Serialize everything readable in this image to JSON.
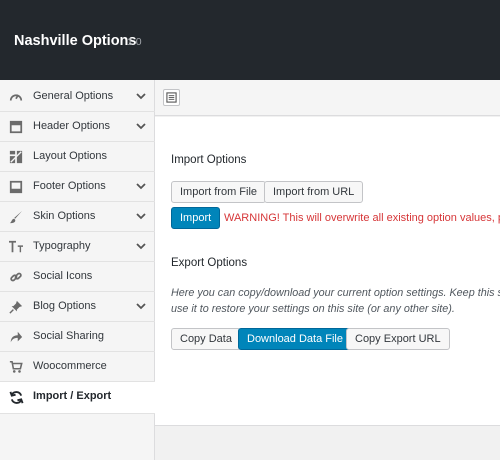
{
  "header": {
    "title": "Nashville Options",
    "version": "1.0"
  },
  "sidebar": {
    "items": [
      {
        "label": "General Options",
        "icon": "gauge-icon",
        "expandable": true
      },
      {
        "label": "Header Options",
        "icon": "header-layout-icon",
        "expandable": true
      },
      {
        "label": "Layout Options",
        "icon": "layout-icon",
        "expandable": false
      },
      {
        "label": "Footer Options",
        "icon": "footer-layout-icon",
        "expandable": true
      },
      {
        "label": "Skin Options",
        "icon": "brush-icon",
        "expandable": true
      },
      {
        "label": "Typography",
        "icon": "typography-icon",
        "expandable": true
      },
      {
        "label": "Social Icons",
        "icon": "link-icon",
        "expandable": false
      },
      {
        "label": "Blog Options",
        "icon": "pin-icon",
        "expandable": true
      },
      {
        "label": "Social Sharing",
        "icon": "share-icon",
        "expandable": false
      },
      {
        "label": "Woocommerce",
        "icon": "cart-icon",
        "expandable": false
      },
      {
        "label": "Import / Export",
        "icon": "refresh-icon",
        "expandable": false,
        "active": true
      }
    ]
  },
  "import": {
    "heading": "Import Options",
    "from_file": "Import from File",
    "from_url": "Import from URL",
    "import_button": "Import",
    "warning": "WARNING! This will overwrite all existing option values, please proceed with caution!"
  },
  "export": {
    "heading": "Export Options",
    "description_line1": "Here you can copy/download your current option settings. Keep this safe as you can",
    "description_line2": "use it to restore your settings on this site (or any other site).",
    "copy_data": "Copy Data",
    "download": "Download Data File",
    "copy_url": "Copy Export URL"
  },
  "colors": {
    "header_bg": "#23282d",
    "primary_button": "#0085ba",
    "warning": "#d63638"
  }
}
